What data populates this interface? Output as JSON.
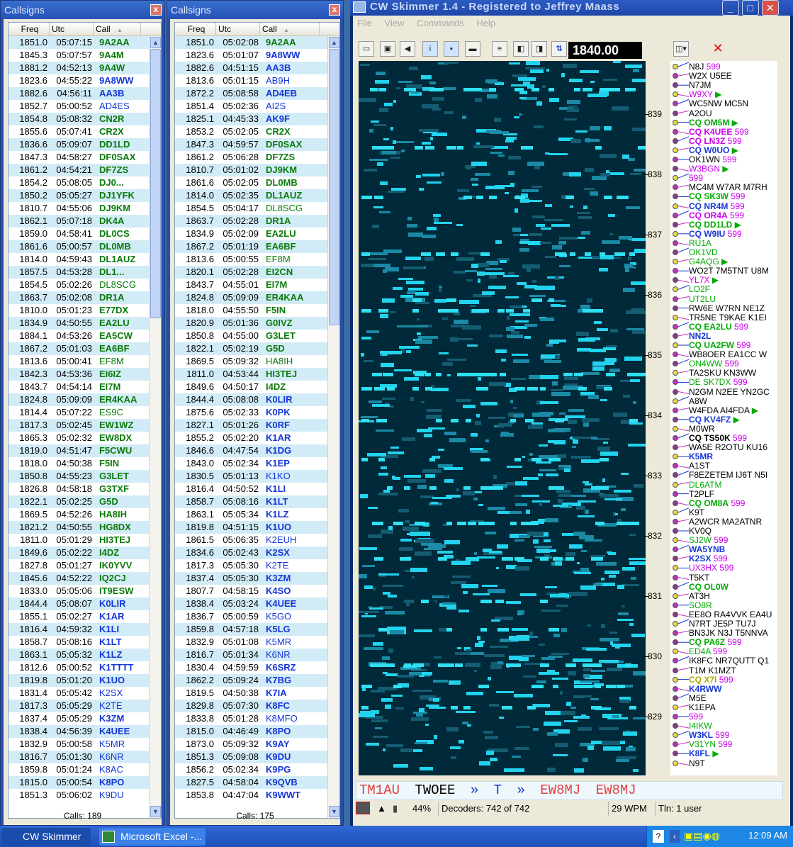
{
  "left_panel": {
    "title": "Callsigns",
    "close": "x",
    "columns": [
      "Freq",
      "Utc",
      "Call"
    ],
    "sort_arrow": "▲",
    "footer": "Calls: 189",
    "rows": [
      [
        "1851.0",
        "05:07:15",
        "9A2AA",
        "#0b7a0b"
      ],
      [
        "1845.3",
        "05:07:57",
        "9A4M",
        "#0b7a0b"
      ],
      [
        "1881.2",
        "04:52:13",
        "9A4W",
        "#0b7a0b"
      ],
      [
        "1823.6",
        "04:55:22",
        "9A8WW",
        "#1436d6"
      ],
      [
        "1882.6",
        "04:56:11",
        "AA3B",
        "#1436d6"
      ],
      [
        "1852.7",
        "05:00:52",
        "AD4ES",
        "#1436d6"
      ],
      [
        "1854.8",
        "05:08:32",
        "CN2R",
        "#0b7a0b"
      ],
      [
        "1855.6",
        "05:07:41",
        "CR2X",
        "#0b7a0b"
      ],
      [
        "1836.6",
        "05:09:07",
        "DD1LD",
        "#0b7a0b"
      ],
      [
        "1847.3",
        "04:58:27",
        "DF0SAX",
        "#0b7a0b"
      ],
      [
        "1861.2",
        "04:54:21",
        "DF7ZS",
        "#0b7a0b"
      ],
      [
        "1854.2",
        "05:08:05",
        "DJ0...",
        "#0b7a0b"
      ],
      [
        "1850.2",
        "05:05:27",
        "DJ1YFK",
        "#0b7a0b"
      ],
      [
        "1810.7",
        "04:55:06",
        "DJ9KM",
        "#0b7a0b"
      ],
      [
        "1862.1",
        "05:07:18",
        "DK4A",
        "#0b7a0b"
      ],
      [
        "1859.0",
        "04:58:41",
        "DL0CS",
        "#0b7a0b"
      ],
      [
        "1861.6",
        "05:00:57",
        "DL0MB",
        "#0b7a0b"
      ],
      [
        "1814.0",
        "04:59:43",
        "DL1AUZ",
        "#0b7a0b"
      ],
      [
        "1857.5",
        "04:53:28",
        "DL1...",
        "#0b7a0b"
      ],
      [
        "1854.5",
        "05:02:26",
        "DL8SCG",
        "#0b7a0b"
      ],
      [
        "1863.7",
        "05:02:08",
        "DR1A",
        "#0b7a0b"
      ],
      [
        "1810.0",
        "05:01:23",
        "E77DX",
        "#0b7a0b"
      ],
      [
        "1834.9",
        "04:50:55",
        "EA2LU",
        "#0b7a0b"
      ],
      [
        "1884.1",
        "04:53:26",
        "EA5CW",
        "#0b7a0b"
      ],
      [
        "1867.2",
        "05:01:03",
        "EA6BF",
        "#0b7a0b"
      ],
      [
        "1813.6",
        "05:00:41",
        "EF8M",
        "#0b7a0b"
      ],
      [
        "1842.3",
        "04:53:36",
        "EI6IZ",
        "#0b7a0b"
      ],
      [
        "1843.7",
        "04:54:14",
        "EI7M",
        "#0b7a0b"
      ],
      [
        "1824.8",
        "05:09:09",
        "ER4KAA",
        "#0b7a0b"
      ],
      [
        "1814.4",
        "05:07:22",
        "ES9C",
        "#0b7a0b"
      ],
      [
        "1817.3",
        "05:02:45",
        "EW1WZ",
        "#0b7a0b"
      ],
      [
        "1865.3",
        "05:02:32",
        "EW8DX",
        "#0b7a0b"
      ],
      [
        "1819.0",
        "04:51:47",
        "F5CWU",
        "#0b7a0b"
      ],
      [
        "1818.0",
        "04:50:38",
        "F5IN",
        "#0b7a0b"
      ],
      [
        "1850.8",
        "04:55:23",
        "G3LET",
        "#0b7a0b"
      ],
      [
        "1826.8",
        "04:58:18",
        "G3TXF",
        "#0b7a0b"
      ],
      [
        "1822.1",
        "05:02:25",
        "G5D",
        "#0b7a0b"
      ],
      [
        "1869.5",
        "04:52:26",
        "HA8IH",
        "#0b7a0b"
      ],
      [
        "1821.2",
        "04:50:55",
        "HG8DX",
        "#0b7a0b"
      ],
      [
        "1811.0",
        "05:01:29",
        "HI3TEJ",
        "#0b7a0b"
      ],
      [
        "1849.6",
        "05:02:22",
        "I4DZ",
        "#0b7a0b"
      ],
      [
        "1827.8",
        "05:01:27",
        "IK0YVV",
        "#0b7a0b"
      ],
      [
        "1845.6",
        "04:52:22",
        "IQ2CJ",
        "#0b7a0b"
      ],
      [
        "1833.0",
        "05:05:06",
        "IT9ESW",
        "#0b7a0b"
      ],
      [
        "1844.4",
        "05:08:07",
        "K0LIR",
        "#1436d6"
      ],
      [
        "1855.1",
        "05:02:27",
        "K1AR",
        "#1436d6"
      ],
      [
        "1816.4",
        "04:59:32",
        "K1LI",
        "#1436d6"
      ],
      [
        "1858.7",
        "05:08:16",
        "K1LT",
        "#1436d6"
      ],
      [
        "1863.1",
        "05:05:32",
        "K1LZ",
        "#1436d6"
      ],
      [
        "1812.6",
        "05:00:52",
        "K1TTTT",
        "#1436d6"
      ],
      [
        "1819.8",
        "05:01:20",
        "K1UO",
        "#1436d6"
      ],
      [
        "1831.4",
        "05:05:42",
        "K2SX",
        "#1436d6"
      ],
      [
        "1817.3",
        "05:05:29",
        "K2TE",
        "#1436d6"
      ],
      [
        "1837.4",
        "05:05:29",
        "K3ZM",
        "#1436d6"
      ],
      [
        "1838.4",
        "04:56:39",
        "K4UEE",
        "#1436d6"
      ],
      [
        "1832.9",
        "05:00:58",
        "K5MR",
        "#1436d6"
      ],
      [
        "1816.7",
        "05:01:30",
        "K6NR",
        "#1436d6"
      ],
      [
        "1859.8",
        "05:01:24",
        "K8AC",
        "#1436d6"
      ],
      [
        "1815.0",
        "05:00:54",
        "K8PO",
        "#1436d6"
      ],
      [
        "1851.3",
        "05:06:02",
        "K9DU",
        "#1436d6"
      ]
    ],
    "normal_calls": [
      "AD4ES",
      "DL8SCG",
      "EF8M",
      "ES9C",
      "K2SX",
      "K2TE",
      "K5MR",
      "K6NR",
      "K8AC",
      "K9DU"
    ]
  },
  "middle_panel": {
    "title": "Callsigns",
    "close": "x",
    "columns": [
      "Freq",
      "Utc",
      "Call"
    ],
    "sort_arrow": "▲",
    "footer": "Calls: 175",
    "rows": [
      [
        "1851.0",
        "05:02:08",
        "9A2AA",
        "#0b7a0b"
      ],
      [
        "1823.6",
        "05:01:07",
        "9A8WW",
        "#1436d6"
      ],
      [
        "1882.6",
        "04:51:15",
        "AA3B",
        "#1436d6"
      ],
      [
        "1813.6",
        "05:01:15",
        "AB9H",
        "#1436d6"
      ],
      [
        "1872.2",
        "05:08:58",
        "AD4EB",
        "#1436d6"
      ],
      [
        "1851.4",
        "05:02:36",
        "AI2S",
        "#1436d6"
      ],
      [
        "1825.1",
        "04:45:33",
        "AK9F",
        "#1436d6"
      ],
      [
        "1853.2",
        "05:02:05",
        "CR2X",
        "#0b7a0b"
      ],
      [
        "1847.3",
        "04:59:57",
        "DF0SAX",
        "#0b7a0b"
      ],
      [
        "1861.2",
        "05:06:28",
        "DF7ZS",
        "#0b7a0b"
      ],
      [
        "1810.7",
        "05:01:02",
        "DJ9KM",
        "#0b7a0b"
      ],
      [
        "1861.6",
        "05:02:05",
        "DL0MB",
        "#0b7a0b"
      ],
      [
        "1814.0",
        "05:02:35",
        "DL1AUZ",
        "#0b7a0b"
      ],
      [
        "1854.5",
        "05:04:17",
        "DL8SCG",
        "#0b7a0b"
      ],
      [
        "1863.7",
        "05:02:28",
        "DR1A",
        "#0b7a0b"
      ],
      [
        "1834.9",
        "05:02:09",
        "EA2LU",
        "#0b7a0b"
      ],
      [
        "1867.2",
        "05:01:19",
        "EA6BF",
        "#0b7a0b"
      ],
      [
        "1813.6",
        "05:00:55",
        "EF8M",
        "#0b7a0b"
      ],
      [
        "1820.1",
        "05:02:28",
        "EI2CN",
        "#0b7a0b"
      ],
      [
        "1843.7",
        "04:55:01",
        "EI7M",
        "#0b7a0b"
      ],
      [
        "1824.8",
        "05:09:09",
        "ER4KAA",
        "#0b7a0b"
      ],
      [
        "1818.0",
        "04:55:50",
        "F5IN",
        "#0b7a0b"
      ],
      [
        "1820.9",
        "05:01:36",
        "G0IVZ",
        "#0b7a0b"
      ],
      [
        "1850.8",
        "04:55:00",
        "G3LET",
        "#0b7a0b"
      ],
      [
        "1822.1",
        "05:02:19",
        "G5D",
        "#0b7a0b"
      ],
      [
        "1869.5",
        "05:09:32",
        "HA8IH",
        "#0b7a0b"
      ],
      [
        "1811.0",
        "04:53:44",
        "HI3TEJ",
        "#0b7a0b"
      ],
      [
        "1849.6",
        "04:50:17",
        "I4DZ",
        "#0b7a0b"
      ],
      [
        "1844.4",
        "05:08:08",
        "K0LIR",
        "#1436d6"
      ],
      [
        "1875.6",
        "05:02:33",
        "K0PK",
        "#1436d6"
      ],
      [
        "1827.1",
        "05:01:26",
        "K0RF",
        "#1436d6"
      ],
      [
        "1855.2",
        "05:02:20",
        "K1AR",
        "#1436d6"
      ],
      [
        "1846.6",
        "04:47:54",
        "K1DG",
        "#1436d6"
      ],
      [
        "1843.0",
        "05:02:34",
        "K1EP",
        "#1436d6"
      ],
      [
        "1830.5",
        "05:01:13",
        "K1KO",
        "#1436d6"
      ],
      [
        "1816.4",
        "04:50:52",
        "K1LI",
        "#1436d6"
      ],
      [
        "1858.7",
        "05:08:16",
        "K1LT",
        "#1436d6"
      ],
      [
        "1863.1",
        "05:05:34",
        "K1LZ",
        "#1436d6"
      ],
      [
        "1819.8",
        "04:51:15",
        "K1UO",
        "#1436d6"
      ],
      [
        "1861.5",
        "05:06:35",
        "K2EUH",
        "#1436d6"
      ],
      [
        "1834.6",
        "05:02:43",
        "K2SX",
        "#1436d6"
      ],
      [
        "1817.3",
        "05:05:30",
        "K2TE",
        "#1436d6"
      ],
      [
        "1837.4",
        "05:05:30",
        "K3ZM",
        "#1436d6"
      ],
      [
        "1807.7",
        "04:58:15",
        "K4SO",
        "#1436d6"
      ],
      [
        "1838.4",
        "05:03:24",
        "K4UEE",
        "#1436d6"
      ],
      [
        "1836.7",
        "05:00:59",
        "K5GO",
        "#1436d6"
      ],
      [
        "1859.8",
        "04:57:18",
        "K5LG",
        "#1436d6"
      ],
      [
        "1832.9",
        "05:01:08",
        "K5MR",
        "#1436d6"
      ],
      [
        "1816.7",
        "05:01:34",
        "K6NR",
        "#1436d6"
      ],
      [
        "1830.4",
        "04:59:59",
        "K6SRZ",
        "#1436d6"
      ],
      [
        "1862.2",
        "05:09:24",
        "K7BG",
        "#1436d6"
      ],
      [
        "1819.5",
        "04:50:38",
        "K7IA",
        "#1436d6"
      ],
      [
        "1829.8",
        "05:07:30",
        "K8FC",
        "#1436d6"
      ],
      [
        "1833.8",
        "05:01:28",
        "K8MFO",
        "#1436d6"
      ],
      [
        "1815.0",
        "04:46:49",
        "K8PO",
        "#1436d6"
      ],
      [
        "1873.0",
        "05:09:32",
        "K9AY",
        "#1436d6"
      ],
      [
        "1851.3",
        "05:09:08",
        "K9DU",
        "#1436d6"
      ],
      [
        "1856.2",
        "05:02:34",
        "K9PG",
        "#1436d6"
      ],
      [
        "1827.5",
        "04:58:04",
        "K9QVB",
        "#1436d6"
      ],
      [
        "1853.8",
        "04:47:04",
        "K9WWT",
        "#1436d6"
      ]
    ],
    "normal_calls": [
      "AB9H",
      "AI2S",
      "DL8SCG",
      "EF8M",
      "HA8IH",
      "K1KO",
      "K2EUH",
      "K2TE",
      "K5GO",
      "K5MR",
      "K6NR",
      "K8MFO"
    ]
  },
  "skimmer": {
    "title": "CW Skimmer 1.4 - Registered to Jeffrey Maass",
    "menu": [
      "File",
      "View",
      "Commands",
      "Help"
    ],
    "frequency": "1840.00",
    "scale_ticks": [
      "839",
      "838",
      "837",
      "836",
      "835",
      "834",
      "833",
      "832",
      "831",
      "830",
      "829"
    ],
    "spots": [
      [
        "N8J 599",
        "#000",
        "#c0e"
      ],
      [
        "W2X U5EE",
        "#000",
        ""
      ],
      [
        "N7JM",
        "#000",
        ""
      ],
      [
        "W9XY ▶",
        "#c0e",
        "#0a0"
      ],
      [
        "WC5NW MC5N",
        "#000",
        ""
      ],
      [
        "A2OU",
        "#000",
        ""
      ],
      [
        "CQ OM5M ▶",
        "#0a0",
        "#0a0"
      ],
      [
        "CQ K4UEE 599",
        "#c0e",
        "#c0e"
      ],
      [
        "CQ LN3Z 599",
        "#c0e",
        "#c0e"
      ],
      [
        "CQ W0UO ▶",
        "#1436d6",
        "#0a0"
      ],
      [
        "OK1WN 599",
        "#000",
        "#c0e"
      ],
      [
        "W3BGN ▶",
        "#c0e",
        "#0a0"
      ],
      [
        "599",
        "#c0e",
        "#c0e"
      ],
      [
        "MC4M W7AR M7RH",
        "#000",
        ""
      ],
      [
        "CQ SK3W 599",
        "#0a0",
        "#c0e"
      ],
      [
        "CQ NR4M 599",
        "#1436d6",
        "#c0e"
      ],
      [
        "CQ OR4A 599",
        "#c0e",
        "#c0e"
      ],
      [
        "CQ DD1LD ▶",
        "#0a0",
        "#0a0"
      ],
      [
        "CQ W9IU 599",
        "#1436d6",
        "#c0e"
      ],
      [
        "RU1A",
        "#0a0",
        ""
      ],
      [
        "OK1VD",
        "#0a0",
        ""
      ],
      [
        "G4AQG ▶",
        "#0a0",
        "#0a0"
      ],
      [
        "WO2T 7M5TNT U8M",
        "#000",
        ""
      ],
      [
        "YL7X ▶",
        "#c0e",
        "#0a0"
      ],
      [
        "LO2F",
        "#0a0",
        ""
      ],
      [
        "UT2LU",
        "#0a0",
        ""
      ],
      [
        "RW6E W7RN NE1Z",
        "#000",
        ""
      ],
      [
        "TR5NE T9KAE K1EI",
        "#000",
        ""
      ],
      [
        "CQ EA2LU 599",
        "#0a0",
        "#c0e"
      ],
      [
        "NN2L",
        "#1436d6",
        ""
      ],
      [
        "CQ UA2FW 599",
        "#0a0",
        "#c0e"
      ],
      [
        "WB8OER EA1CC W",
        "#000",
        ""
      ],
      [
        "ON4WW 599",
        "#0a0",
        "#c0e"
      ],
      [
        "TA2SKU KN3WW",
        "#000",
        ""
      ],
      [
        "DE SK7DX 599",
        "#0a0",
        "#c0e"
      ],
      [
        "N2GM N2EE YN2GC",
        "#000",
        ""
      ],
      [
        "A8W",
        "#000",
        ""
      ],
      [
        "W4FDA AI4FDA ▶",
        "#000",
        "#0a0"
      ],
      [
        "CQ KV4FZ ▶",
        "#1436d6",
        "#0a0"
      ],
      [
        "M0WR",
        "#000",
        ""
      ],
      [
        "CQ TS50K 599",
        "#000",
        "#c0e"
      ],
      [
        "WA5E R2OTU KU16",
        "#000",
        ""
      ],
      [
        "K5MR",
        "#1436d6",
        ""
      ],
      [
        "A1ST",
        "#000",
        ""
      ],
      [
        "F8EZETEM IJ6T N5I",
        "#000",
        ""
      ],
      [
        "DL6ATM",
        "#0a0",
        ""
      ],
      [
        "T2PLF",
        "#000",
        ""
      ],
      [
        "CQ OM8A 599",
        "#0a0",
        "#c0e"
      ],
      [
        "K9T",
        "#000",
        ""
      ],
      [
        "A2WCR MA2ATNR",
        "#000",
        ""
      ],
      [
        "KV0Q",
        "#000",
        ""
      ],
      [
        "SJ2W 599",
        "#0a0",
        "#c0e"
      ],
      [
        "WA5YNB",
        "#1436d6",
        ""
      ],
      [
        "K2SX 599",
        "#1436d6",
        "#c0e"
      ],
      [
        "UX3HX 599",
        "#c0e",
        "#c0e"
      ],
      [
        "T5KT",
        "#000",
        ""
      ],
      [
        "CQ OL0W",
        "#0a0",
        ""
      ],
      [
        "AT3H",
        "#000",
        ""
      ],
      [
        "SO8R",
        "#0a0",
        ""
      ],
      [
        "EE8O RA4VVK EA4U",
        "#000",
        ""
      ],
      [
        "N7RT JE5P TU7J",
        "#000",
        ""
      ],
      [
        "BN3JK N3J T5NNVA",
        "#000",
        ""
      ],
      [
        "CQ PA6Z 599",
        "#0a0",
        "#c0e"
      ],
      [
        "ED4A 599",
        "#0a0",
        "#c0e"
      ],
      [
        "IK8FC NR7QUTT Q1",
        "#000",
        ""
      ],
      [
        "T1M K1MZT",
        "#000",
        ""
      ],
      [
        "CQ X7I 599",
        "#aa0",
        "#c0e"
      ],
      [
        "K4RWW",
        "#1436d6",
        ""
      ],
      [
        "M5E",
        "#000",
        ""
      ],
      [
        "K1EPA",
        "#000",
        ""
      ],
      [
        "599",
        "#c0e",
        "#c0e"
      ],
      [
        "I4IKW",
        "#0a0",
        ""
      ],
      [
        "W3KL 599",
        "#1436d6",
        "#c0e"
      ],
      [
        "V31YN 599",
        "#0a0",
        "#c0e"
      ],
      [
        "K8FL ▶",
        "#1436d6",
        "#0a0"
      ],
      [
        "N9T",
        "#000",
        ""
      ]
    ],
    "decoder": {
      "text1": "TM1AU",
      "text2": "TWOEE",
      "arrow": "»",
      "text3": "T",
      "text4": "EW8MJ",
      "text5": "EW8MJ"
    },
    "status": {
      "percent": "44%",
      "decoders": "Decoders: 742 of 742",
      "wpm": "29 WPM",
      "tln": "Tln: 1 user"
    }
  },
  "taskbar": {
    "items": [
      "CW Skimmer",
      "Microsoft Excel -..."
    ],
    "clock": "12:09 AM"
  }
}
